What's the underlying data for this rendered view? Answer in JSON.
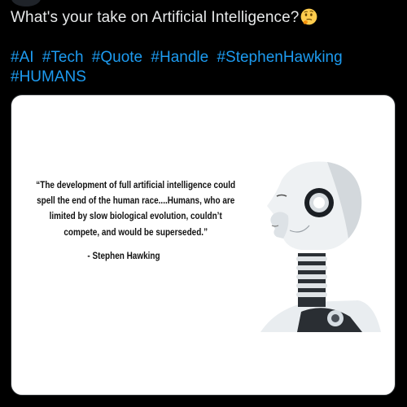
{
  "tweet": {
    "text": "What's your take on Artificial Intelligence?",
    "emoji": "thinking-face-emoji",
    "hashtags": [
      "#AI",
      "#Tech",
      "#Quote",
      "#Handle",
      "#StephenHawking",
      "#HUMANS"
    ]
  },
  "media": {
    "quote": "“The development of full artificial intelligence could spell the end of the human race....Humans, who are limited by slow biological evolution, couldn’t compete, and would be superseded.”",
    "author": "- Stephen Hawking",
    "image": "robot-head-illustration"
  },
  "colors": {
    "background": "#000000",
    "text": "#e7e9ea",
    "link": "#1d9bf0",
    "card": "#ffffff"
  }
}
